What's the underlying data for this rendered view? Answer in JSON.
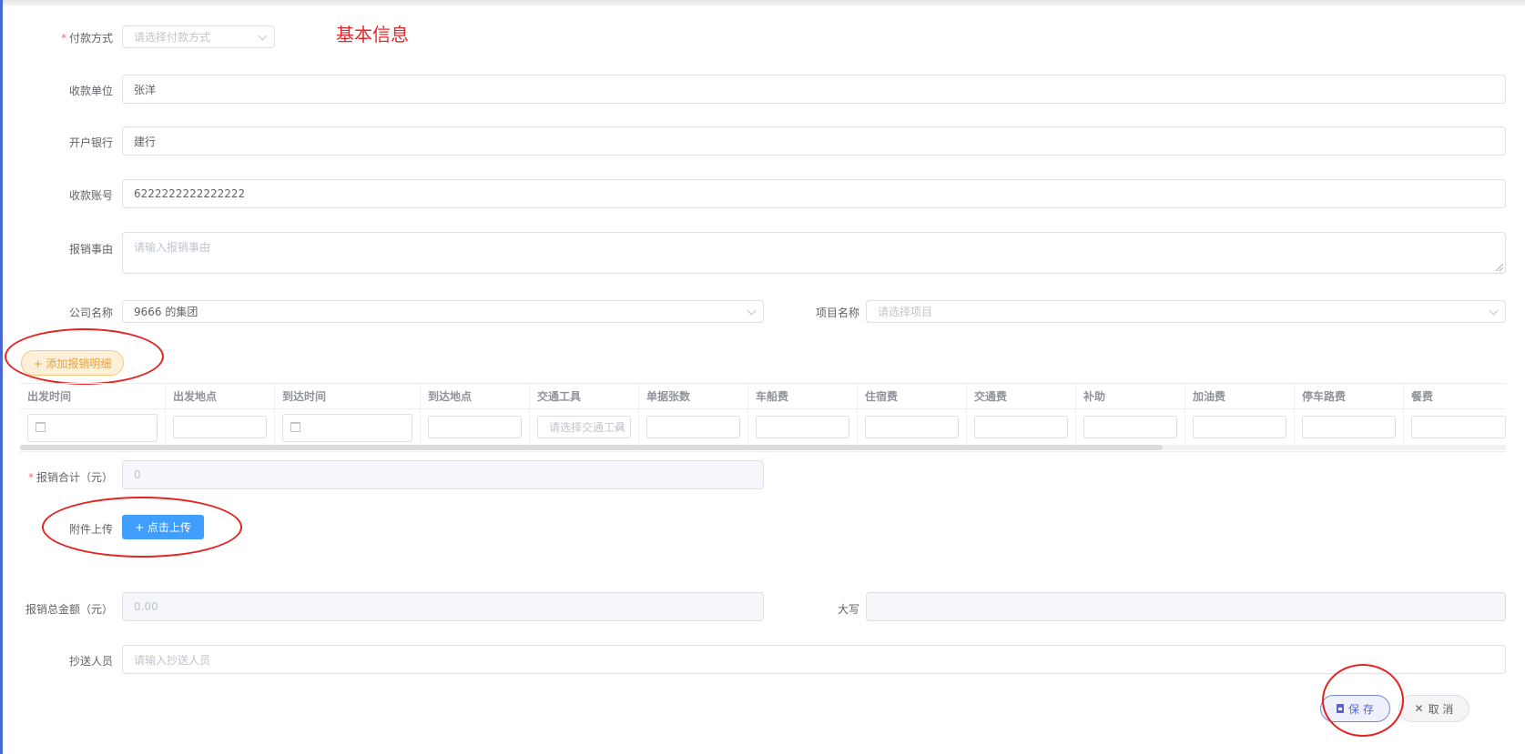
{
  "form": {
    "section_title": "基本信息",
    "payment_method": {
      "label": "付款方式",
      "placeholder": "请选择付款方式"
    },
    "payee": {
      "label": "收款单位",
      "value": "张洋"
    },
    "bank": {
      "label": "开户银行",
      "value": "建行"
    },
    "account": {
      "label": "收款账号",
      "value": "6222222222222222"
    },
    "reason": {
      "label": "报销事由",
      "placeholder": "请输入报销事由"
    },
    "company": {
      "label": "公司名称",
      "value": "9666 的集团"
    },
    "project": {
      "label": "项目名称",
      "placeholder": "请选择项目"
    },
    "add_detail_button": "+ 添加报销明细",
    "total": {
      "label": "报销合计（元）",
      "value": "0"
    },
    "attachment": {
      "label": "附件上传",
      "button": "+ 点击上传"
    },
    "grand_total": {
      "label": "报销总金额（元）",
      "value": "0.00"
    },
    "capital": {
      "label": "大写",
      "value": ""
    },
    "cc": {
      "label": "抄送人员",
      "placeholder": "请输入抄送人员"
    }
  },
  "table": {
    "columns": [
      "出发时间",
      "出发地点",
      "到达时间",
      "到达地点",
      "交通工具",
      "单据张数",
      "车船费",
      "住宿费",
      "交通费",
      "补助",
      "加油费",
      "停车路费",
      "餐费"
    ],
    "transport_placeholder": "请选择交通工具"
  },
  "actions": {
    "save": "保 存",
    "cancel": "取 消"
  },
  "colors": {
    "primary": "#409eff",
    "annotation": "#e52222",
    "warning": "#e6a23c",
    "save_accent": "#5b63c9"
  }
}
